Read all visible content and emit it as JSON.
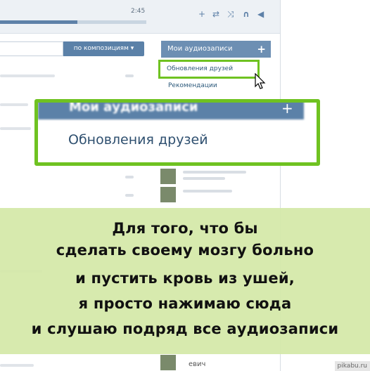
{
  "player": {
    "time": "2:45",
    "progress": 0.53,
    "controls": [
      {
        "name": "add-icon",
        "glyph": "+"
      },
      {
        "name": "repeat-icon",
        "glyph": "⇄"
      },
      {
        "name": "shuffle-icon",
        "glyph": "⤨"
      },
      {
        "name": "headphones-icon",
        "glyph": "∩"
      },
      {
        "name": "broadcast-icon",
        "glyph": "◀"
      }
    ]
  },
  "search": {
    "placeholder": "",
    "button_label": "по композициям ▾"
  },
  "sidebar": {
    "header": "Мои аудиозаписи",
    "header_plus": "+",
    "items": [
      {
        "label": "Обновления друзей"
      },
      {
        "label": "Рекомендации"
      }
    ]
  },
  "zoom": {
    "header": "Мои аудиозаписи",
    "header_plus": "+",
    "item": "Обновления друзей"
  },
  "caption": {
    "lines": [
      "Для того, что бы",
      "сделать своему мозгу больно",
      "и пустить кровь из  ушей,",
      "я просто нажимаю сюда",
      "и слушаю подряд все аудиозаписи"
    ]
  },
  "footer": {
    "partial_name": "евич",
    "watermark": "pikabu.ru"
  },
  "colors": {
    "accent": "#5b81a8",
    "highlight": "#6fc221",
    "banner": "#d4e8a8"
  }
}
